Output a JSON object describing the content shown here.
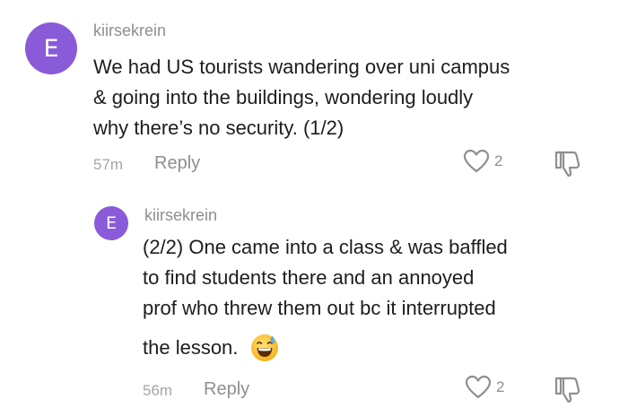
{
  "comments": [
    {
      "avatar_letter": "E",
      "username": "kiirsekrein",
      "text": "We had US tourists wandering over uni campus\n& going into the buildings, wondering loudly\nwhy there’s no security. (1/2)",
      "time": "57m",
      "reply_label": "Reply",
      "likes": "2",
      "icons": {
        "like": "heart-outline-icon",
        "dislike": "thumbs-down-outline-icon"
      }
    },
    {
      "avatar_letter": "E",
      "username": "kiirsekrein",
      "text": "(2/2) One came into a class & was baffled\nto find students there and an annoyed\nprof who threw them out bc it interrupted",
      "last_line": "the lesson.",
      "emoji": "grinning-face-with-sweat-emoji",
      "time": "56m",
      "reply_label": "Reply",
      "likes": "2",
      "icons": {
        "like": "heart-outline-icon",
        "dislike": "thumbs-down-outline-icon"
      }
    }
  ],
  "colors": {
    "avatar": "#8a5bd9",
    "username": "#8e8e93",
    "text": "#1d1d1f",
    "meta": "#a6a6ab"
  }
}
